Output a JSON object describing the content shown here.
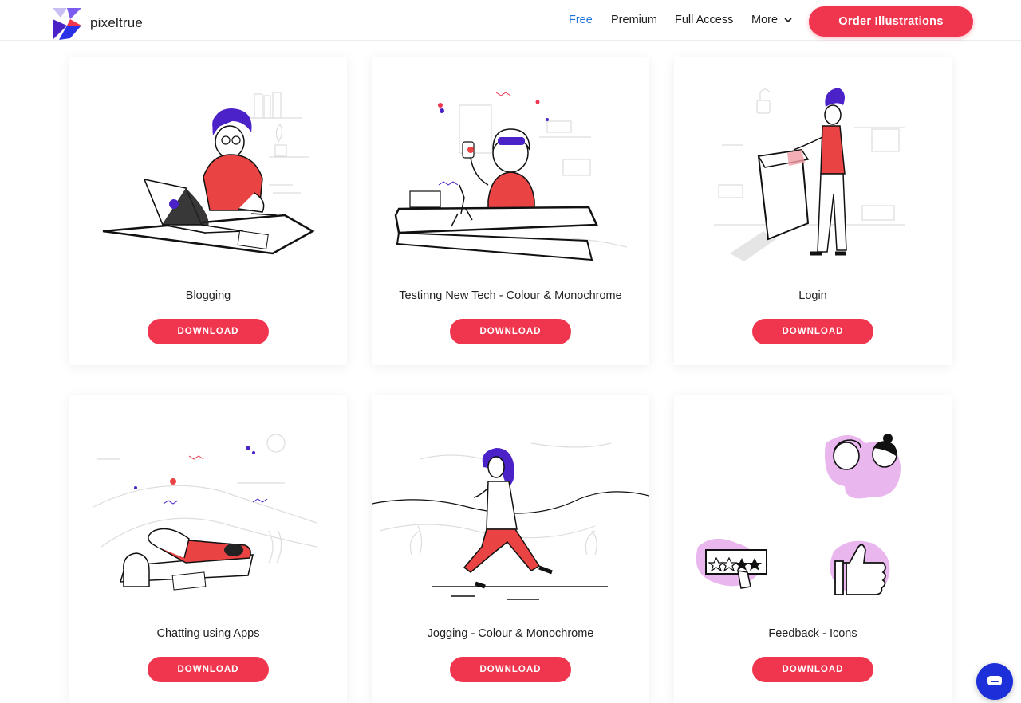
{
  "header": {
    "brand": "pixeltrue",
    "nav": [
      "Free",
      "Premium",
      "Full Access",
      "More"
    ],
    "order_label": "Order Illustrations"
  },
  "cards": [
    {
      "title": "Blogging",
      "button": "DOWNLOAD"
    },
    {
      "title": "Testinng New Tech - Colour & Monochrome",
      "button": "DOWNLOAD"
    },
    {
      "title": "Login",
      "button": "DOWNLOAD"
    },
    {
      "title": "Chatting using Apps",
      "button": "DOWNLOAD"
    },
    {
      "title": "Jogging - Colour & Monochrome",
      "button": "DOWNLOAD"
    },
    {
      "title": "Feedback - Icons",
      "button": "DOWNLOAD"
    }
  ],
  "colors": {
    "accent": "#f0364f",
    "active_nav": "#1f74d9",
    "purple": "#4a22c8",
    "chat": "#1c2fd9"
  },
  "icons": [
    "pixeltrue-logo",
    "chevron-down-icon",
    "chat-icon"
  ]
}
